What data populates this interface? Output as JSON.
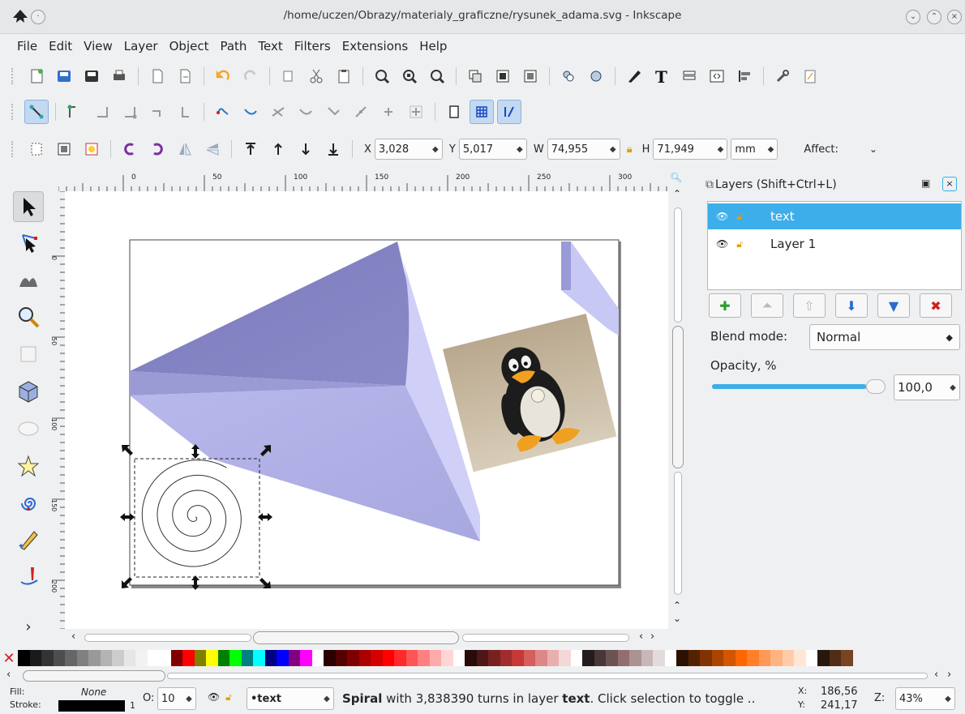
{
  "window": {
    "title": "/home/uczen/Obrazy/materialy_graficzne/rysunek_adama.svg - Inkscape"
  },
  "menu": [
    "File",
    "Edit",
    "View",
    "Layer",
    "Object",
    "Path",
    "Text",
    "Filters",
    "Extensions",
    "Help"
  ],
  "selector_controls": {
    "x_label": "X",
    "x_value": "3,028",
    "y_label": "Y",
    "y_value": "5,017",
    "w_label": "W",
    "w_value": "74,955",
    "h_label": "H",
    "h_value": "71,949",
    "unit": "mm",
    "affect_label": "Affect:"
  },
  "ruler": {
    "ticks": [
      "0",
      "50",
      "100",
      "150",
      "200",
      "250",
      "300"
    ],
    "vticks": [
      "0",
      "50",
      "100",
      "150",
      "200",
      "250"
    ]
  },
  "layers_panel": {
    "title": "Layers (Shift+Ctrl+L)",
    "layers": [
      {
        "name": "text",
        "selected": true
      },
      {
        "name": "Layer 1",
        "selected": false
      }
    ],
    "blend_mode_label": "Blend mode:",
    "blend_mode_value": "Normal",
    "opacity_label": "Opacity, %",
    "opacity_value": "100,0",
    "opacity_level": 1.0
  },
  "status": {
    "fill_label": "Fill:",
    "fill_value": "None",
    "stroke_label": "Stroke:",
    "stroke_width": "1",
    "opacity_label": "O:",
    "opacity_value": "10",
    "layer_value": "•text",
    "message_bold1": "Spiral",
    "message_part1": " with 3,838390 turns in layer ",
    "message_bold2": "text",
    "message_part2": ". Click selection to toggle ..",
    "coord_x_label": "X:",
    "coord_x": "186,56",
    "coord_y_label": "Y:",
    "coord_y": "241,17",
    "zoom_label": "Z:",
    "zoom_value": "43%"
  },
  "colors": {
    "accent": "#3daee9",
    "pyramid_dark": "#8080c0",
    "pyramid_mid": "#a8a8e0",
    "pyramid_light": "#d0d0ff"
  }
}
